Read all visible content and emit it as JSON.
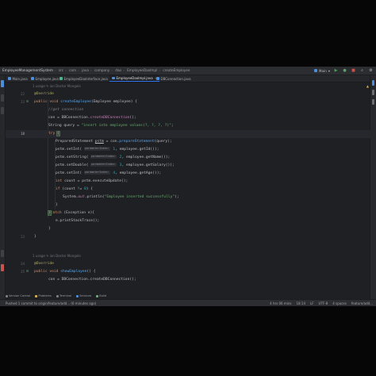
{
  "breadcrumbs": [
    "EmployeeManagementSystem",
    "src",
    "com",
    "java",
    "company",
    "dao",
    "EmployeeDaoImpl",
    "createEmployee"
  ],
  "toolbar": {
    "run_config": "Main",
    "status_icons": [
      "run-icon",
      "debug-icon",
      "stop-icon",
      "search-icon",
      "gear-icon"
    ]
  },
  "tabs": [
    {
      "label": "Main.java",
      "color": "#4c8ed9",
      "active": false
    },
    {
      "label": "Employee.java",
      "color": "#4c8ed9",
      "active": false
    },
    {
      "label": "EmployeeDaoInterface.java",
      "color": "#4cb58e",
      "active": false
    },
    {
      "label": "EmployeeDaoImpl.java",
      "color": "#4c8ed9",
      "active": true
    },
    {
      "label": "DBConnection.java",
      "color": "#4c8ed9",
      "active": false
    }
  ],
  "editor": {
    "hint1": "1 usage  ✎ ian Doctor Mongole",
    "hint2": "1 usage  ✎ ian Doctor Mongole",
    "line_numbers": {
      "l0": "",
      "l1": "22",
      "l2": "23",
      "l3": "",
      "l4": "",
      "l5": "",
      "l6": "18",
      "l7": "",
      "l8": "",
      "l9": "",
      "l10": "",
      "l11": "",
      "l12": "",
      "l13": "",
      "l14": "",
      "l15": "",
      "l16": "",
      "l17": "",
      "l18": "",
      "l19": "23",
      "l20": "",
      "l21": "",
      "l22": "",
      "l23": "34",
      "l24": "35",
      "l25": ""
    },
    "override1": "@Override",
    "m1_public": "public ",
    "m1_void": "void ",
    "m1_name": "createEmployee",
    "m1_params": "(Employee employee) {",
    "comment": "//get connection",
    "con_assign": "con = ",
    "con_class": "DBConnection.",
    "con_method": "createDBConnection",
    "con_end": "();",
    "q_type": "String query = ",
    "q_str": "\"insert into employee values(?, ?, ?, ?)\"",
    "q_end": ";",
    "try": "try ",
    "try_brace": "{",
    "ps_type": "PreparedStatement ",
    "ps_var": "pstm",
    "ps_mid": " = con.",
    "ps_fn": "prepareStatement",
    "ps_end": "(query);",
    "set1_pre": "pstm.setInt( ",
    "set1_hint": "parameterIndex:",
    "set1_num": " 1",
    "set1_post": ", employee.getId());",
    "set2_pre": "pstm.setString( ",
    "set2_hint": "parameterIndex:",
    "set2_num": " 2",
    "set2_post": ", employee.getName());",
    "set3_pre": "pstm.setDouble( ",
    "set3_hint": "parameterIndex:",
    "set3_num": " 3",
    "set3_post": ", employee.getSalary());",
    "set4_pre": "pstm.setInt( ",
    "set4_hint": "parameterIndex:",
    "set4_num": " 4",
    "set4_post": ", employee.getAge());",
    "cnt_kw": "int ",
    "cnt_rest": "count = pstm.executeUpdate();",
    "if_kw": "if ",
    "if_cond": "(count != ",
    "if_num": "0",
    "if_end": ") {",
    "sout_pre": "System.",
    "sout_out": "out",
    "sout_fn": ".println(",
    "sout_str": "\"Employee inserted successfully\"",
    "sout_end": ");",
    "close_if": "}",
    "catch_brace": "}",
    "catch_kw": "catch ",
    "catch_rest": "(Exception e){",
    "trace": "e.printStackTrace();",
    "close_catch": "}",
    "close_method": "}",
    "override2": "@Override",
    "m2_public": "public ",
    "m2_void": "void ",
    "m2_name": "showEmployee",
    "m2_params": "() {",
    "last_line": "con = DBConnection.createDBConnection();"
  },
  "bottom_tools": [
    "Version Control",
    "Problems",
    "Terminal",
    "Services",
    "Build"
  ],
  "status": {
    "left": "Pushed 1 commit to origin/feature/add... (6 minutes ago)",
    "position": "4 hrs 06 mins",
    "cursor": "18:14",
    "line_sep": "LF",
    "encoding": "UTF-8",
    "indent": "4 spaces",
    "branch": "feature/add..."
  }
}
